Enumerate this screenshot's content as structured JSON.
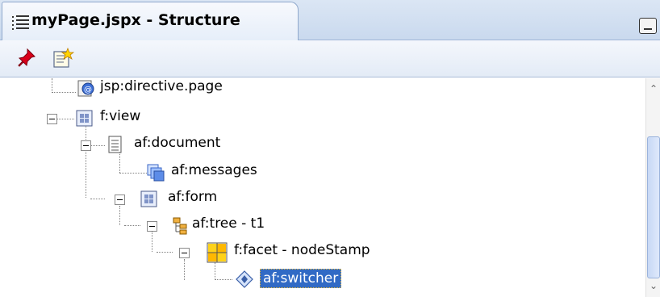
{
  "panel": {
    "title": "myPage.jspx - Structure",
    "icon": "structure-icon"
  },
  "toolbar": {
    "buttons": [
      {
        "name": "pin-icon"
      },
      {
        "name": "edit-properties-icon"
      }
    ]
  },
  "tree": {
    "nodes": [
      {
        "label": "jsp:directive.page",
        "icon": "jsp-directive-icon",
        "depth": 1,
        "expandable": false
      },
      {
        "label": "f:view",
        "icon": "view-icon",
        "depth": 0,
        "expandable": true
      },
      {
        "label": "af:document",
        "icon": "document-icon",
        "depth": 1,
        "expandable": true
      },
      {
        "label": "af:messages",
        "icon": "messages-icon",
        "depth": 2,
        "expandable": false
      },
      {
        "label": "af:form",
        "icon": "form-icon",
        "depth": 1,
        "expandable": true
      },
      {
        "label": "af:tree - t1",
        "icon": "tree-icon",
        "depth": 2,
        "expandable": true
      },
      {
        "label": "f:facet - nodeStamp",
        "icon": "facet-icon",
        "depth": 3,
        "expandable": true
      },
      {
        "label": "af:switcher",
        "icon": "switcher-icon",
        "depth": 4,
        "expandable": false,
        "selected": true
      }
    ]
  },
  "colors": {
    "selection": "#316ac5",
    "tab_border": "#8fa8cc"
  }
}
